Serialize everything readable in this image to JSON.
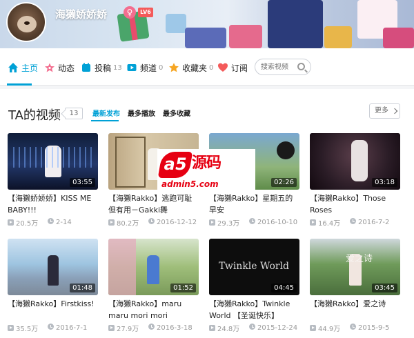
{
  "user": {
    "name": "海獭娇娇娇",
    "gender_symbol": "♀",
    "level": "LV6"
  },
  "nav": {
    "items": [
      {
        "label": "主页",
        "count": "",
        "icon": "home-icon",
        "color": "#00a1d6"
      },
      {
        "label": "动态",
        "count": "",
        "icon": "activity-icon",
        "color": "#f36e8f"
      },
      {
        "label": "投稿",
        "count": "13",
        "icon": "upload-icon",
        "color": "#00a1d6"
      },
      {
        "label": "频道",
        "count": "0",
        "icon": "channel-icon",
        "color": "#00a1d6"
      },
      {
        "label": "收藏夹",
        "count": "0",
        "icon": "favorites-icon",
        "color": "#f6a623"
      },
      {
        "label": "订阅",
        "count": "",
        "icon": "subscribe-icon",
        "color": "#f45a5a"
      }
    ],
    "search_placeholder": "搜索视频"
  },
  "videos_section": {
    "title": "TA的视频",
    "count": "13",
    "sort_tabs": [
      "最新发布",
      "最多播放",
      "最多收藏"
    ],
    "more_label": "更多"
  },
  "videos": [
    {
      "title": "【海獭娇娇娇】KISS ME BABY!!!",
      "duration": "03:55",
      "views": "20.5万",
      "date": "2-14"
    },
    {
      "title": "【海獭Rakko】逃跑可耻但有用－Gakki舞",
      "duration": "",
      "views": "80.2万",
      "date": "2016-12-12"
    },
    {
      "title": "【海獭Rakko】星期五的早安",
      "duration": "02:26",
      "views": "29.3万",
      "date": "2016-10-10"
    },
    {
      "title": "【海獭Rakko】Those Roses",
      "duration": "03:18",
      "views": "16.4万",
      "date": "2016-7-2"
    },
    {
      "title": "【海獭Rakko】Firstkiss!",
      "duration": "01:48",
      "views": "35.5万",
      "date": "2016-7-1"
    },
    {
      "title": "【海獭Rakko】maru maru mori mori",
      "duration": "01:52",
      "views": "27.9万",
      "date": "2016-3-18"
    },
    {
      "title": "【海獭Rakko】Twinkle World 【圣诞快乐】",
      "duration": "04:45",
      "views": "24.8万",
      "date": "2015-12-24",
      "thumb_text": "Twinkle World"
    },
    {
      "title": "【海獭Rakko】爱之诗",
      "duration": "03:45",
      "views": "44.9万",
      "date": "2015-9-5",
      "thumb_text": "爱之诗"
    }
  ],
  "watermark": {
    "mark": "a5",
    "brand": "源码",
    "url": "admin5.com"
  }
}
